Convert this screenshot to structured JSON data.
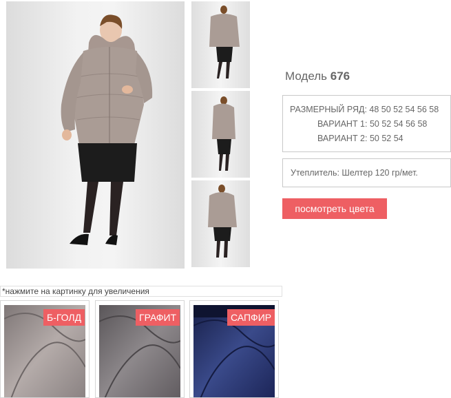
{
  "product": {
    "model_label": "Модель",
    "model_number": "676"
  },
  "sizes": {
    "row_label": "РАЗМЕРНЫЙ РЯД:",
    "row_values": "48 50 52 54 56 58",
    "variant1_label": "ВАРИАНТ 1:",
    "variant1_values": "50 52 54 56 58",
    "variant2_label": "ВАРИАНТ 2:",
    "variant2_values": "50 52 54"
  },
  "insulation": "Утеплитель: Шелтер 120 гр/мет.",
  "colors_button": "посмотреть цвета",
  "hint": "*нажмите на картинку для увеличения",
  "swatches": [
    {
      "label": "Б-ГОЛД",
      "color": "#9a9090"
    },
    {
      "label": "ГРАФИТ",
      "color": "#6f6a6e"
    },
    {
      "label": "САПФИР",
      "color": "#1f2a5e"
    }
  ],
  "colors": {
    "accent": "#ee5f63",
    "coat": "#a89a93",
    "skirt": "#1c1c1c"
  }
}
